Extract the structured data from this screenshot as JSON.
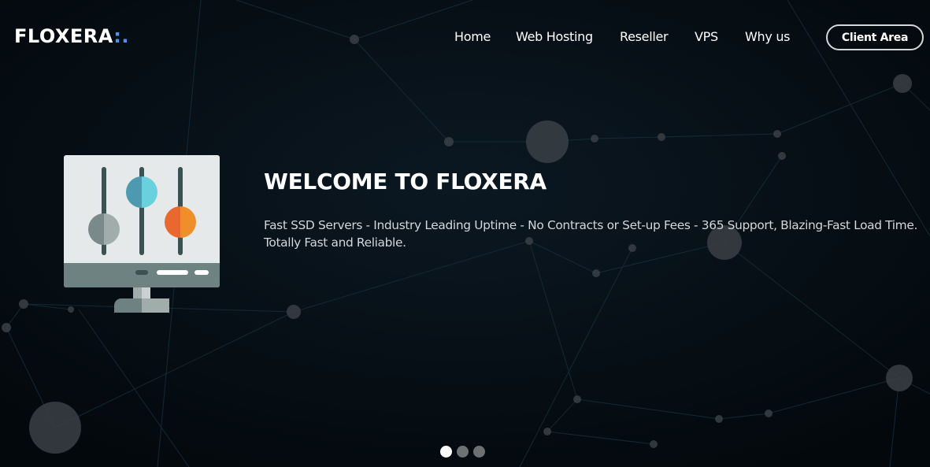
{
  "brand": {
    "name": "FLOXERA",
    "suffix": ":.",
    "accent_color": "#4f8ff2"
  },
  "nav": {
    "items": [
      {
        "label": "Home"
      },
      {
        "label": "Web Hosting"
      },
      {
        "label": "Reseller"
      },
      {
        "label": "VPS"
      },
      {
        "label": "Why us"
      }
    ],
    "client_area_label": "Client Area"
  },
  "hero": {
    "title": "WELCOME TO FLOXERA",
    "description": "Fast SSD Servers - Industry Leading Uptime - No Contracts or Set-up Fees - 365 Support, Blazing-Fast Load Time. Totally Fast and Reliable.",
    "illustration": "monitor-equalizer-icon",
    "colors": {
      "screen": "#e6e9ea",
      "bezel": "#6f8282",
      "slider_track": "#3a5254",
      "knob_gray_left": "#7a8989",
      "knob_gray_right": "#a0adab",
      "knob_blue_left": "#4c99b0",
      "knob_blue_right": "#69d1de",
      "knob_orange_left": "#e86830",
      "knob_orange_right": "#f08f2a"
    }
  },
  "carousel": {
    "slide_count": 3,
    "active_index": 0
  }
}
